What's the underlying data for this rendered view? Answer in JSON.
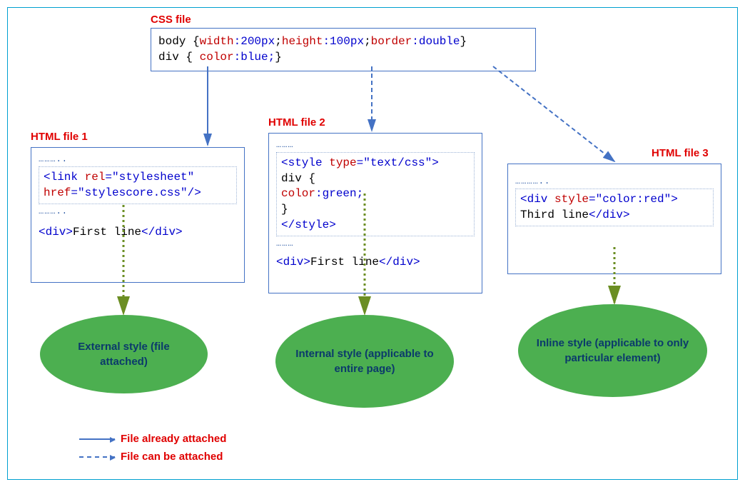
{
  "labels": {
    "css_file": "CSS file",
    "html1": "HTML file 1",
    "html2": "HTML file 2",
    "html3": "HTML file 3"
  },
  "css_box": {
    "line1_pre": "body {",
    "line1_p1": "width",
    "line1_v1": ":200px",
    "line1_p2": "height",
    "line1_v2": ":100px",
    "line1_p3": "border",
    "line1_v3": ":double",
    "line1_post": "}",
    "line2_pre": "div { ",
    "line2_p1": "color",
    "line2_v1": ":blue;",
    "line2_post": "}"
  },
  "html1_box": {
    "link_tag_open": "<link",
    "rel_attr": " rel",
    "rel_val": "=\"stylesheet\"",
    "href_attr": "href",
    "href_val": "=\"stylescore.css\"",
    "link_close": "/>",
    "dots": "………..",
    "div_open": "<div>",
    "div_text": "First line",
    "div_close": "</div>"
  },
  "html2_box": {
    "dots_top": "………",
    "style_open": "<style",
    "type_attr": " type",
    "type_val": "=\"text/css\"",
    "style_open_end": ">",
    "selector": " div {",
    "prop_indent": "    ",
    "prop": "color",
    "prop_val": ":green;",
    "close_brace": " }",
    "style_close": "</style>",
    "dots_bottom": "………",
    "div_open": "<div>",
    "div_text": "First line",
    "div_close": "</div>"
  },
  "html3_box": {
    "dots_top": "…………..",
    "div_open": "<div",
    "style_attr": " style",
    "style_val": "=\"color:red\"",
    "div_open_end": ">",
    "div_text": "Third line",
    "div_close": "</div>"
  },
  "ellipses": {
    "external": "External style (file attached)",
    "internal": "Internal style (applicable to entire page)",
    "inline": "Inline style (applicable to only particular element)"
  },
  "legend": {
    "solid": "File already attached",
    "dashed": "File can be attached"
  }
}
